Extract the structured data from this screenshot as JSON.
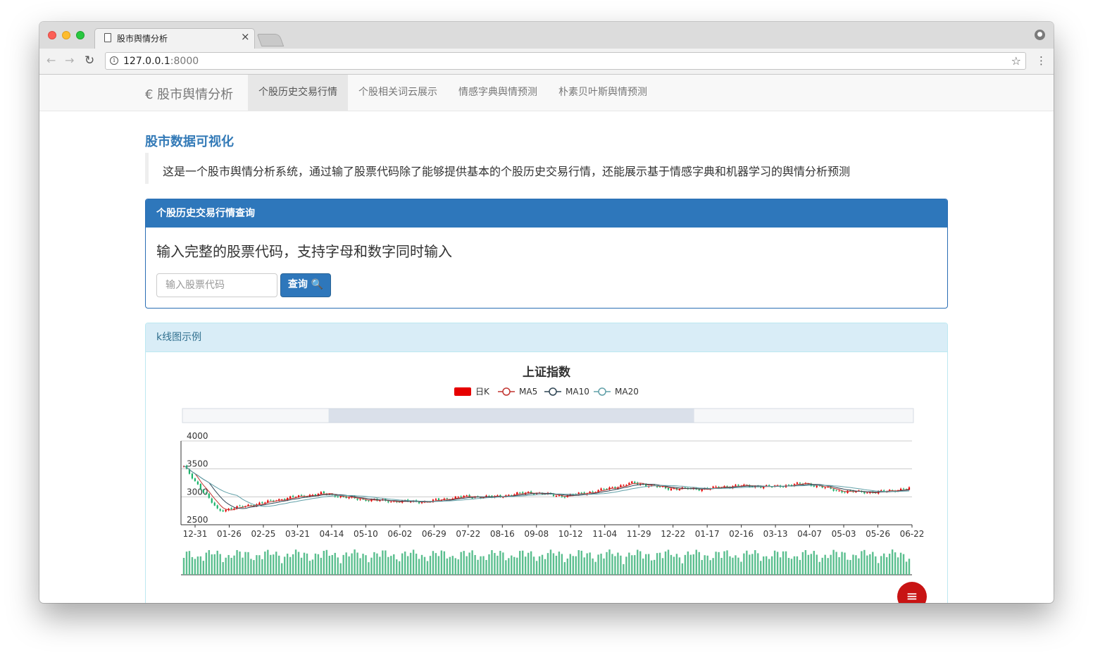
{
  "browser": {
    "tab_title": "股市舆情分析",
    "tab_close": "×",
    "url_host": "127.0.0.1",
    "url_port": ":8000",
    "back_glyph": "←",
    "forward_glyph": "→",
    "reload_glyph": "↻",
    "info_glyph": "i",
    "star_glyph": "☆",
    "menu_glyph": "⋮",
    "profile_glyph": "●"
  },
  "navbar": {
    "brand": "€ 股市舆情分析",
    "items": [
      {
        "label": "个股历史交易行情",
        "active": true
      },
      {
        "label": "个股相关词云展示",
        "active": false
      },
      {
        "label": "情感字典舆情预测",
        "active": false
      },
      {
        "label": "朴素贝叶斯舆情预测",
        "active": false
      }
    ]
  },
  "page": {
    "heading": "股市数据可视化",
    "description": "这是一个股市舆情分析系统，通过输了股票代码除了能够提供基本的个股历史交易行情，还能展示基于情感字典和机器学习的舆情分析预测"
  },
  "search_panel": {
    "title": "个股历史交易行情查询",
    "hint": "输入完整的股票代码，支持字母和数字同时输入",
    "input_placeholder": "输入股票代码",
    "input_value": "",
    "button_label": "查询 🔍"
  },
  "chart_panel": {
    "title": "k线图示例"
  },
  "fab_glyph": "≡",
  "colors": {
    "primary": "#2e77bb",
    "up": "#e60000",
    "down": "#1bb36b",
    "ma5": "#c23531",
    "ma10": "#2f4554",
    "ma20": "#61a0a8"
  },
  "chart_data": {
    "type": "candlestick",
    "title": "上证指数",
    "legend": [
      "日K",
      "MA5",
      "MA10",
      "MA20"
    ],
    "legend_position": "top-center",
    "ylim": [
      2500,
      4000
    ],
    "yticks": [
      4000,
      3500,
      3000,
      2500
    ],
    "grid": true,
    "xticks": [
      "12-31",
      "01-26",
      "02-25",
      "03-21",
      "04-14",
      "05-10",
      "06-02",
      "06-29",
      "07-22",
      "08-16",
      "09-08",
      "10-12",
      "11-04",
      "11-29",
      "12-22",
      "01-17",
      "02-16",
      "03-13",
      "04-07",
      "05-03",
      "05-26",
      "06-22"
    ],
    "close_at_ticks": [
      3540,
      2750,
      2860,
      2980,
      3060,
      2960,
      2920,
      2910,
      3000,
      3000,
      3080,
      3010,
      3110,
      3250,
      3150,
      3140,
      3200,
      3180,
      3240,
      3100,
      3080,
      3150
    ],
    "datazoom_range_pct": [
      20,
      70
    ],
    "volume_panel": true
  }
}
